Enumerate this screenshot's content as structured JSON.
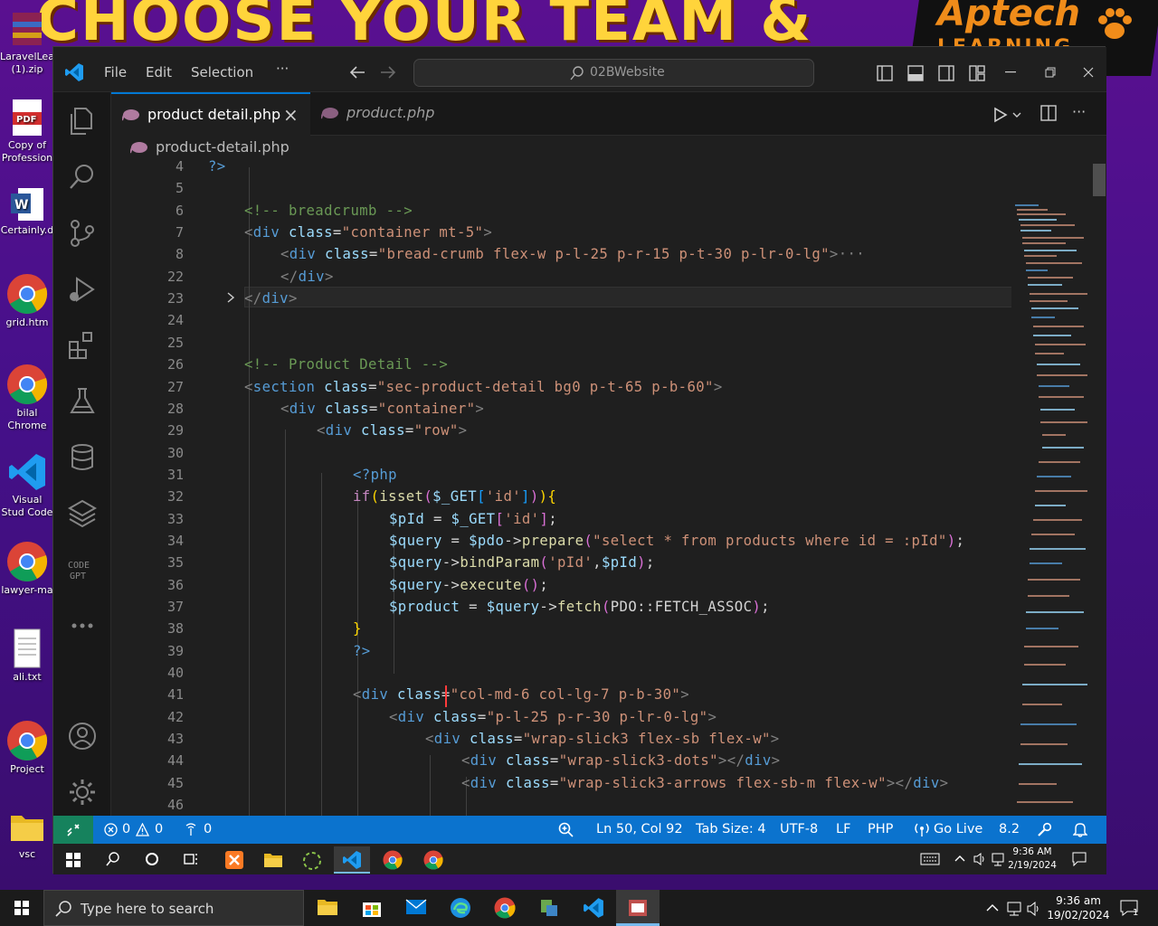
{
  "wallpaper": {
    "banner": "CHOOSE YOUR TEAM &",
    "logo_main": "Aptech",
    "logo_sub": "LEARNING"
  },
  "desktop_icons": [
    {
      "label": "LaravelLea (1).zip",
      "icon": "winrar-icon"
    },
    {
      "label": "Copy of Profession",
      "icon": "pdf-icon"
    },
    {
      "label": "Certainly.d",
      "icon": "word-icon"
    },
    {
      "label": "grid.htm",
      "icon": "chrome-icon"
    },
    {
      "label": "bilal Chrome",
      "icon": "chrome-icon"
    },
    {
      "label": "Visual Stud Code",
      "icon": "vscode-icon"
    },
    {
      "label": "lawyer-ma",
      "icon": "chrome-icon"
    },
    {
      "label": "ali.txt",
      "icon": "text-file-icon"
    },
    {
      "label": "Project",
      "icon": "chrome-icon"
    },
    {
      "label": "vsc",
      "icon": "folder-icon"
    }
  ],
  "titlebar": {
    "menu": [
      "File",
      "Edit",
      "Selection",
      "···"
    ],
    "search": "02BWebsite"
  },
  "tabs": [
    {
      "label": "product detail.php",
      "active": true,
      "close": "×"
    },
    {
      "label": "product.php",
      "active": false
    }
  ],
  "breadcrumb": "product-detail.php",
  "editor": {
    "lines": [
      {
        "n": "4",
        "tokens": [
          [
            "c-php",
            "?>"
          ]
        ],
        "indent": 0
      },
      {
        "n": "5",
        "tokens": [],
        "indent": 0
      },
      {
        "n": "6",
        "tokens": [
          [
            "c-com",
            "<!-- breadcrumb -->"
          ]
        ],
        "indent": 1
      },
      {
        "n": "7",
        "tokens": [
          [
            "c-ang",
            "<"
          ],
          [
            "c-tag",
            "div"
          ],
          [
            "c-plain",
            " "
          ],
          [
            "c-attr",
            "class"
          ],
          [
            "c-plain",
            "="
          ],
          [
            "c-str",
            "\"container mt-5\""
          ],
          [
            "c-ang",
            ">"
          ]
        ],
        "indent": 1
      },
      {
        "n": "8",
        "tokens": [
          [
            "c-ang",
            "<"
          ],
          [
            "c-tag",
            "div"
          ],
          [
            "c-plain",
            " "
          ],
          [
            "c-attr",
            "class"
          ],
          [
            "c-plain",
            "="
          ],
          [
            "c-str",
            "\"bread-crumb flex-w p-l-25 p-r-15 p-t-30 p-lr-0-lg\""
          ],
          [
            "c-ang",
            ">"
          ],
          [
            "c-ang",
            "···"
          ]
        ],
        "indent": 2
      },
      {
        "n": "22",
        "tokens": [
          [
            "c-ang",
            "</"
          ],
          [
            "c-tag",
            "div"
          ],
          [
            "c-ang",
            ">"
          ]
        ],
        "indent": 2
      },
      {
        "n": "23",
        "tokens": [
          [
            "c-ang",
            "</"
          ],
          [
            "c-tag",
            "div"
          ],
          [
            "c-ang",
            ">"
          ]
        ],
        "indent": 1
      },
      {
        "n": "24",
        "tokens": [],
        "indent": 0
      },
      {
        "n": "25",
        "tokens": [],
        "indent": 0
      },
      {
        "n": "26",
        "tokens": [
          [
            "c-com",
            "<!-- Product Detail -->"
          ]
        ],
        "indent": 1
      },
      {
        "n": "27",
        "tokens": [
          [
            "c-ang",
            "<"
          ],
          [
            "c-tag",
            "section"
          ],
          [
            "c-plain",
            " "
          ],
          [
            "c-attr",
            "class"
          ],
          [
            "c-plain",
            "="
          ],
          [
            "c-str",
            "\"sec-product-detail bg0 p-t-65 p-b-60\""
          ],
          [
            "c-ang",
            ">"
          ]
        ],
        "indent": 1
      },
      {
        "n": "28",
        "tokens": [
          [
            "c-ang",
            "<"
          ],
          [
            "c-tag",
            "div"
          ],
          [
            "c-plain",
            " "
          ],
          [
            "c-attr",
            "class"
          ],
          [
            "c-plain",
            "="
          ],
          [
            "c-str",
            "\"container\""
          ],
          [
            "c-ang",
            ">"
          ]
        ],
        "indent": 2
      },
      {
        "n": "29",
        "tokens": [
          [
            "c-ang",
            "<"
          ],
          [
            "c-tag",
            "div"
          ],
          [
            "c-plain",
            " "
          ],
          [
            "c-attr",
            "class"
          ],
          [
            "c-plain",
            "="
          ],
          [
            "c-str",
            "\"row\""
          ],
          [
            "c-ang",
            ">"
          ]
        ],
        "indent": 3
      },
      {
        "n": "30",
        "tokens": [],
        "indent": 0
      },
      {
        "n": "31",
        "tokens": [
          [
            "c-php",
            "<?php"
          ]
        ],
        "indent": 4
      },
      {
        "n": "32",
        "tokens": [
          [
            "c-kw",
            "if"
          ],
          [
            "c-br1",
            "("
          ],
          [
            "c-fn",
            "isset"
          ],
          [
            "c-br2",
            "("
          ],
          [
            "c-var",
            "$_GET"
          ],
          [
            "c-br3",
            "["
          ],
          [
            "c-str",
            "'id'"
          ],
          [
            "c-br3",
            "]"
          ],
          [
            "c-br2",
            ")"
          ],
          [
            "c-br1",
            ")"
          ],
          [
            "c-br1",
            "{"
          ]
        ],
        "indent": 4
      },
      {
        "n": "33",
        "tokens": [
          [
            "c-var",
            "$pId"
          ],
          [
            "c-plain",
            " = "
          ],
          [
            "c-var",
            "$_GET"
          ],
          [
            "c-br2",
            "["
          ],
          [
            "c-str",
            "'id'"
          ],
          [
            "c-br2",
            "]"
          ],
          [
            "c-plain",
            ";"
          ]
        ],
        "indent": 5
      },
      {
        "n": "34",
        "tokens": [
          [
            "c-var",
            "$query"
          ],
          [
            "c-plain",
            " = "
          ],
          [
            "c-var",
            "$pdo"
          ],
          [
            "c-plain",
            "->"
          ],
          [
            "c-fn",
            "prepare"
          ],
          [
            "c-br2",
            "("
          ],
          [
            "c-str",
            "\"select * from products where id = :pId\""
          ],
          [
            "c-br2",
            ")"
          ],
          [
            "c-plain",
            ";"
          ]
        ],
        "indent": 5
      },
      {
        "n": "35",
        "tokens": [
          [
            "c-var",
            "$query"
          ],
          [
            "c-plain",
            "->"
          ],
          [
            "c-fn",
            "bindParam"
          ],
          [
            "c-br2",
            "("
          ],
          [
            "c-str",
            "'pId'"
          ],
          [
            "c-plain",
            ","
          ],
          [
            "c-var",
            "$pId"
          ],
          [
            "c-br2",
            ")"
          ],
          [
            "c-plain",
            ";"
          ]
        ],
        "indent": 5
      },
      {
        "n": "36",
        "tokens": [
          [
            "c-var",
            "$query"
          ],
          [
            "c-plain",
            "->"
          ],
          [
            "c-fn",
            "execute"
          ],
          [
            "c-br2",
            "()"
          ],
          [
            "c-plain",
            ";"
          ]
        ],
        "indent": 5
      },
      {
        "n": "37",
        "tokens": [
          [
            "c-var",
            "$product"
          ],
          [
            "c-plain",
            " = "
          ],
          [
            "c-var",
            "$query"
          ],
          [
            "c-plain",
            "->"
          ],
          [
            "c-fn",
            "fetch"
          ],
          [
            "c-br2",
            "("
          ],
          [
            "c-plain",
            "PDO::FETCH_ASSOC"
          ],
          [
            "c-br2",
            ")"
          ],
          [
            "c-plain",
            ";"
          ]
        ],
        "indent": 5
      },
      {
        "n": "38",
        "tokens": [
          [
            "c-br1",
            "}"
          ]
        ],
        "indent": 4
      },
      {
        "n": "39",
        "tokens": [
          [
            "c-php",
            "?>"
          ]
        ],
        "indent": 4
      },
      {
        "n": "40",
        "tokens": [],
        "indent": 0
      },
      {
        "n": "41",
        "tokens": [
          [
            "c-ang",
            "<"
          ],
          [
            "c-tag",
            "div"
          ],
          [
            "c-plain",
            " "
          ],
          [
            "c-attr",
            "class"
          ],
          [
            "c-plain",
            "="
          ],
          [
            "c-str",
            "\"col-md-6 col-lg-7 p-b-30\""
          ],
          [
            "c-ang",
            ">"
          ]
        ],
        "indent": 4
      },
      {
        "n": "42",
        "tokens": [
          [
            "c-ang",
            "<"
          ],
          [
            "c-tag",
            "div"
          ],
          [
            "c-plain",
            " "
          ],
          [
            "c-attr",
            "class"
          ],
          [
            "c-plain",
            "="
          ],
          [
            "c-str",
            "\"p-l-25 p-r-30 p-lr-0-lg\""
          ],
          [
            "c-ang",
            ">"
          ]
        ],
        "indent": 5
      },
      {
        "n": "43",
        "tokens": [
          [
            "c-ang",
            "<"
          ],
          [
            "c-tag",
            "div"
          ],
          [
            "c-plain",
            " "
          ],
          [
            "c-attr",
            "class"
          ],
          [
            "c-plain",
            "="
          ],
          [
            "c-str",
            "\"wrap-slick3 flex-sb flex-w\""
          ],
          [
            "c-ang",
            ">"
          ]
        ],
        "indent": 6
      },
      {
        "n": "44",
        "tokens": [
          [
            "c-ang",
            "<"
          ],
          [
            "c-tag",
            "div"
          ],
          [
            "c-plain",
            " "
          ],
          [
            "c-attr",
            "class"
          ],
          [
            "c-plain",
            "="
          ],
          [
            "c-str",
            "\"wrap-slick3-dots\""
          ],
          [
            "c-ang",
            "></"
          ],
          [
            "c-tag",
            "div"
          ],
          [
            "c-ang",
            ">"
          ]
        ],
        "indent": 7
      },
      {
        "n": "45",
        "tokens": [
          [
            "c-ang",
            "<"
          ],
          [
            "c-tag",
            "div"
          ],
          [
            "c-plain",
            " "
          ],
          [
            "c-attr",
            "class"
          ],
          [
            "c-plain",
            "="
          ],
          [
            "c-str",
            "\"wrap-slick3-arrows flex-sb-m flex-w\""
          ],
          [
            "c-ang",
            "></"
          ],
          [
            "c-tag",
            "div"
          ],
          [
            "c-ang",
            ">"
          ]
        ],
        "indent": 7
      },
      {
        "n": "46",
        "tokens": [],
        "indent": 0
      }
    ]
  },
  "statusbar": {
    "errors": "0",
    "warnings": "0",
    "ports": "0",
    "position": "Ln 50, Col 92",
    "tab_size": "Tab Size: 4",
    "encoding": "UTF-8",
    "eol": "LF",
    "language": "PHP",
    "go_live": "Go Live",
    "php_version": "8.2"
  },
  "inner_taskbar": {
    "time": "9:36 AM",
    "date": "2/19/2024"
  },
  "taskbar": {
    "search_placeholder": "Type here to search",
    "time": "9:36 am",
    "date": "19/02/2024",
    "notifications": "1"
  },
  "colors": {
    "accent": "#0078d4",
    "statusbar": "#0b73ce",
    "remote": "#16825d"
  }
}
